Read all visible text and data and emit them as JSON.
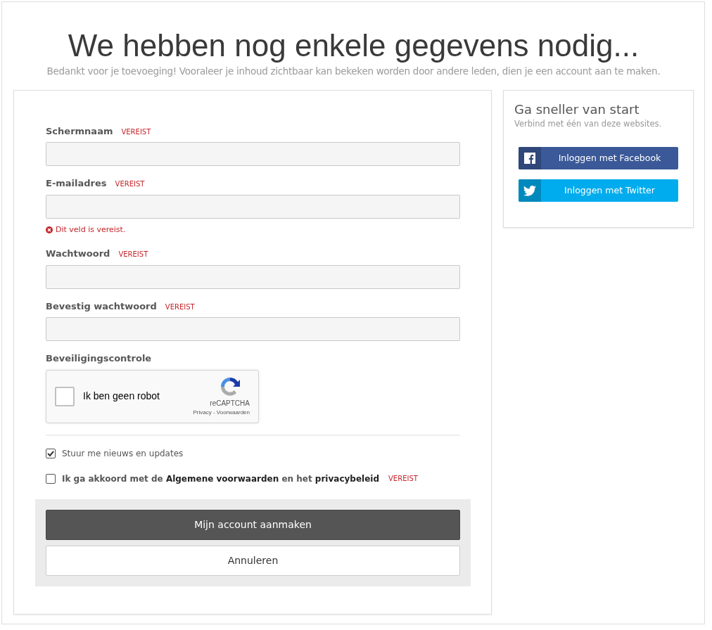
{
  "heading": {
    "title": "We hebben nog enkele gegevens nodig...",
    "subtitle": "Bedankt voor je toevoeging! Vooraleer je inhoud zichtbaar kan bekeken worden door andere leden, dien je een account aan te maken."
  },
  "form": {
    "fields": [
      {
        "label": "Schermnaam",
        "required_tag": "VEREIST"
      },
      {
        "label": "E-mailadres",
        "required_tag": "VEREIST",
        "error": "Dit veld is vereist."
      },
      {
        "label": "Wachtwoord",
        "required_tag": "VEREIST"
      },
      {
        "label": "Bevestig wachtwoord",
        "required_tag": "VEREIST"
      }
    ],
    "captcha": {
      "label": "Beveiligingscontrole",
      "checkbox_text": "Ik ben geen robot",
      "checked": false,
      "brand": "reCAPTCHA",
      "links": "Privacy - Voorwaarden"
    },
    "options": [
      {
        "checked": true,
        "bold": false,
        "parts": [
          {
            "kind": "plain",
            "text": "Stuur me nieuws en updates"
          }
        ]
      },
      {
        "checked": false,
        "bold": true,
        "required_tag": "VEREIST",
        "parts": [
          {
            "kind": "plain",
            "text": "Ik ga akkoord met de "
          },
          {
            "kind": "link",
            "text": "Algemene voorwaarden"
          },
          {
            "kind": "plain",
            "text": " en het "
          },
          {
            "kind": "link",
            "text": "privacybeleid"
          }
        ]
      }
    ],
    "submit": "Mijn account aanmaken",
    "cancel": "Annuleren"
  },
  "sidebar": {
    "title": "Ga sneller van start",
    "subtitle": "Verbind met één van deze websites.",
    "buttons": [
      {
        "kind": "facebook",
        "label": "Inloggen met Facebook"
      },
      {
        "kind": "twitter",
        "label": "Inloggen met Twitter"
      }
    ]
  }
}
